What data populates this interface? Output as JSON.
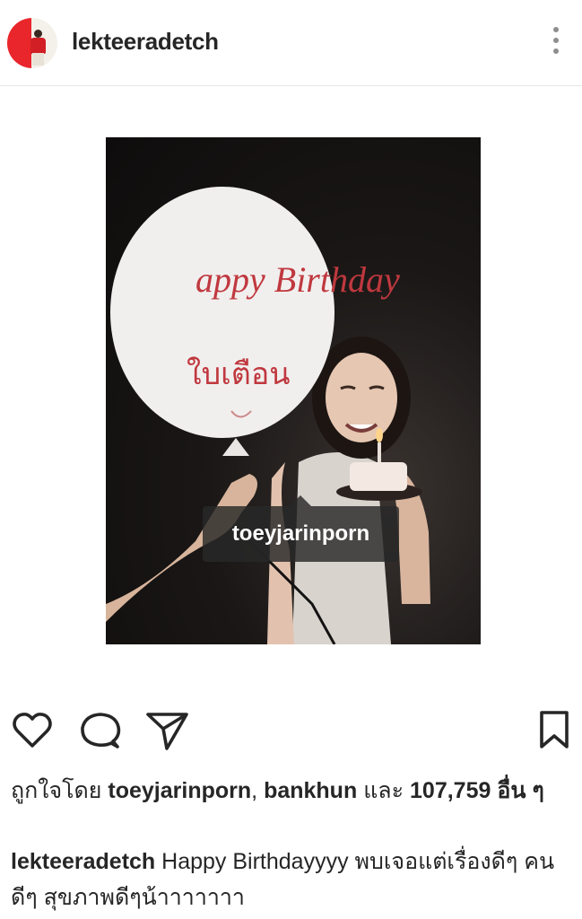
{
  "header": {
    "username": "lekteeradetch",
    "avatar_colors": [
      "#e9262b",
      "#f4f0ea"
    ],
    "more_icon": "more-vertical-icon"
  },
  "photo": {
    "balloon_text_line1": "appy Birthday",
    "balloon_text_line2": "ใบเตือน",
    "tag_label": "toeyjarinporn",
    "balloon_ink_color": "#c0383f"
  },
  "actions": {
    "like_icon": "heart-icon",
    "comment_icon": "comment-icon",
    "share_icon": "send-icon",
    "save_icon": "bookmark-icon"
  },
  "likes": {
    "prefix": "ถูกใจโดย",
    "user1": "toeyjarinporn",
    "sep": ",",
    "user2": "bankhun",
    "and": "และ",
    "count": "107,759",
    "suffix": "อื่น ๆ"
  },
  "caption": {
    "username": "lekteeradetch",
    "text": "Happy Birthdayyyy พบเจอแต่เรื่องดีๆ คนดีๆ สุขภาพดีๆน้าาาาาาา"
  }
}
